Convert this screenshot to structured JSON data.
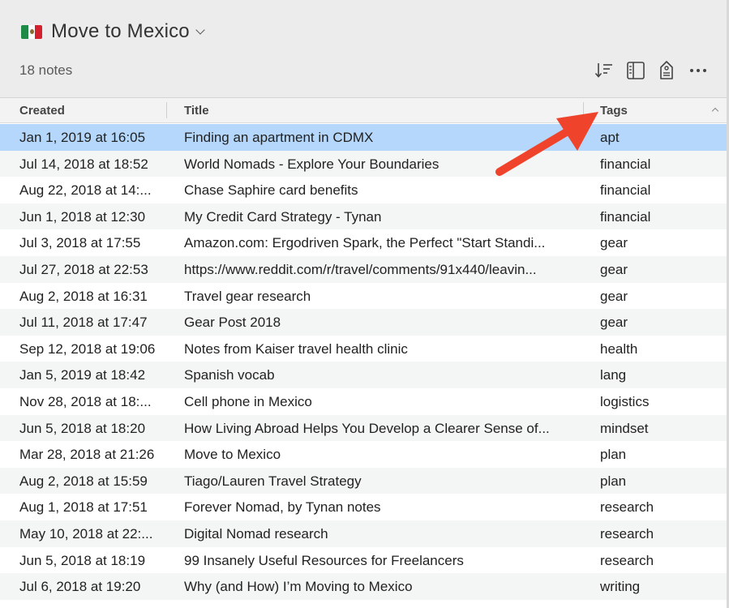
{
  "notebook": {
    "title": "Move to Mexico",
    "note_count": "18 notes",
    "flag_icon": "mexico-flag-icon"
  },
  "toolbar": {
    "icons": [
      "sort-icon",
      "view-options-icon",
      "tag-icon",
      "more-icon"
    ]
  },
  "columns": {
    "created": "Created",
    "title": "Title",
    "tags": "Tags"
  },
  "sort": {
    "column": "Tags",
    "direction": "ascending"
  },
  "rows": [
    {
      "created": "Jan 1, 2019 at 16:05",
      "title": "Finding an apartment in CDMX",
      "tags": "apt",
      "selected": true
    },
    {
      "created": "Jul 14, 2018 at 18:52",
      "title": "World Nomads - Explore Your Boundaries",
      "tags": "financial"
    },
    {
      "created": "Aug 22, 2018 at 14:...",
      "title": "Chase Saphire card benefits",
      "tags": "financial"
    },
    {
      "created": "Jun 1, 2018 at 12:30",
      "title": "My Credit Card Strategy - Tynan",
      "tags": "financial"
    },
    {
      "created": "Jul 3, 2018 at 17:55",
      "title": "Amazon.com: Ergodriven Spark, the Perfect \"Start Standi...",
      "tags": "gear"
    },
    {
      "created": "Jul 27, 2018 at 22:53",
      "title": "https://www.reddit.com/r/travel/comments/91x440/leavin...",
      "tags": "gear"
    },
    {
      "created": "Aug 2, 2018 at 16:31",
      "title": "Travel gear research",
      "tags": "gear"
    },
    {
      "created": "Jul 11, 2018 at 17:47",
      "title": "Gear Post 2018",
      "tags": "gear"
    },
    {
      "created": "Sep 12, 2018 at 19:06",
      "title": "Notes from Kaiser travel health clinic",
      "tags": "health"
    },
    {
      "created": "Jan 5, 2019 at 18:42",
      "title": "Spanish vocab",
      "tags": "lang"
    },
    {
      "created": "Nov 28, 2018 at 18:...",
      "title": "Cell phone in Mexico",
      "tags": "logistics"
    },
    {
      "created": "Jun 5, 2018 at 18:20",
      "title": "How Living Abroad Helps You Develop a Clearer Sense of...",
      "tags": "mindset"
    },
    {
      "created": "Mar 28, 2018 at 21:26",
      "title": "Move to Mexico",
      "tags": "plan"
    },
    {
      "created": "Aug 2, 2018 at 15:59",
      "title": "Tiago/Lauren Travel Strategy",
      "tags": "plan"
    },
    {
      "created": "Aug 1, 2018 at 17:51",
      "title": "Forever Nomad, by Tynan notes",
      "tags": "research"
    },
    {
      "created": "May 10, 2018 at 22:...",
      "title": "Digital Nomad research",
      "tags": "research"
    },
    {
      "created": "Jun 5, 2018 at 18:19",
      "title": "99 Insanely Useful Resources for Freelancers",
      "tags": "research"
    },
    {
      "created": "Jul 6, 2018 at 19:20",
      "title": "Why (and How) I’m Moving to Mexico",
      "tags": "writing"
    }
  ],
  "colors": {
    "selection": "#b4d7fb",
    "annotation_arrow": "#f0432c",
    "header_bg": "#ececec"
  }
}
